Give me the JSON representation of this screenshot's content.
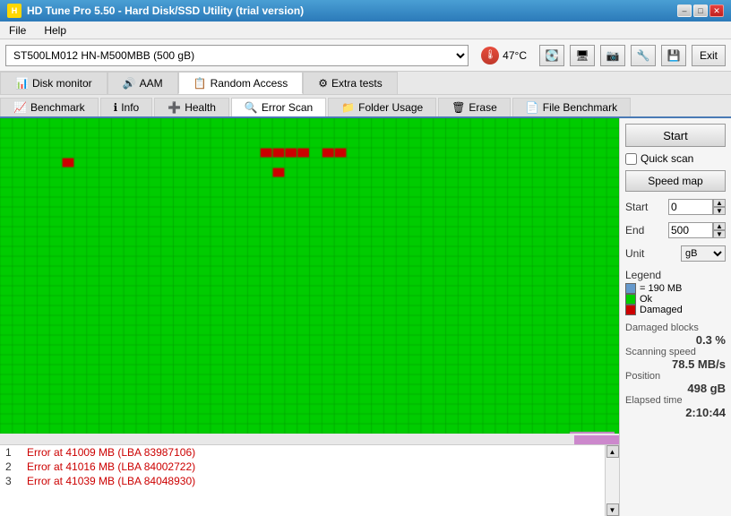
{
  "titleBar": {
    "title": "HD Tune Pro 5.50 - Hard Disk/SSD Utility (trial version)",
    "buttons": [
      "minimize",
      "maximize",
      "close"
    ]
  },
  "menuBar": {
    "items": [
      "File",
      "Help"
    ]
  },
  "toolbar": {
    "driveLabel": "ST500LM012 HN-M500MBB (500 gB)",
    "temperature": "47°C",
    "exitLabel": "Exit"
  },
  "tabs1": [
    {
      "label": "Disk monitor",
      "active": false
    },
    {
      "label": "AAM",
      "active": false
    },
    {
      "label": "Random Access",
      "active": true
    },
    {
      "label": "Extra tests",
      "active": false
    }
  ],
  "tabs2": [
    {
      "label": "Benchmark",
      "active": false
    },
    {
      "label": "Info",
      "active": false
    },
    {
      "label": "Health",
      "active": false
    },
    {
      "label": "Error Scan",
      "active": true
    },
    {
      "label": "Folder Usage",
      "active": false
    },
    {
      "label": "Erase",
      "active": false
    },
    {
      "label": "File Benchmark",
      "active": false
    }
  ],
  "rightPanel": {
    "startLabel": "Start",
    "quickScanLabel": "Quick scan",
    "quickScanChecked": false,
    "speedMapLabel": "Speed map",
    "startParam": "0",
    "endParam": "500",
    "unit": "gB",
    "unitOptions": [
      "MB",
      "gB"
    ],
    "legend": {
      "title": "Legend",
      "blockSize": "= 190 MB",
      "okLabel": "Ok",
      "damagedLabel": "Damaged"
    },
    "stats": {
      "damagedBlocksLabel": "Damaged blocks",
      "damagedBlocksValue": "0.3 %",
      "scanningSpeedLabel": "Scanning speed",
      "scanningSpeedValue": "78.5 MB/s",
      "positionLabel": "Position",
      "positionValue": "498 gB",
      "elapsedTimeLabel": "Elapsed time",
      "elapsedTimeValue": "2:10:44"
    }
  },
  "errorLog": [
    {
      "num": "1",
      "text": "Error at 41009 MB (LBA 83987106)"
    },
    {
      "num": "2",
      "text": "Error at 41016 MB (LBA 84002722)"
    },
    {
      "num": "3",
      "text": "Error at 41039 MB (LBA 84048930)"
    }
  ]
}
